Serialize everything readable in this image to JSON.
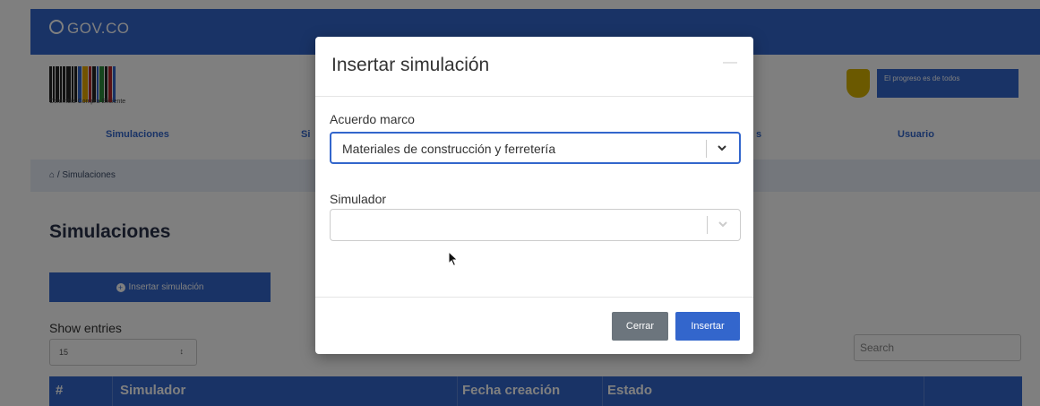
{
  "gov_bar": {
    "logo_text": "GOV.CO"
  },
  "brand": {
    "caption": "Colombia Compra Eficiente"
  },
  "gov_badge": {
    "text": "El progreso es de todos"
  },
  "nav": {
    "items": [
      {
        "label": "Simulaciones"
      },
      {
        "label": "Si"
      },
      {
        "label": "s"
      },
      {
        "label": "Usuario"
      }
    ]
  },
  "breadcrumb": {
    "home_icon": "home-icon",
    "text": "/ Simulaciones"
  },
  "main": {
    "title": "Simulaciones",
    "insert_button": "Insertar simulación",
    "show_entries": "Show entries",
    "entries_value": "15",
    "search_placeholder": "Search",
    "table_headers": [
      "#",
      "Simulador",
      "Fecha creación",
      "Estado"
    ]
  },
  "modal": {
    "title": "Insertar simulación",
    "fields": [
      {
        "label": "Acuerdo marco",
        "value": "Materiales de construcción y ferretería"
      },
      {
        "label": "Simulador",
        "value": ""
      }
    ],
    "close_button": "Cerrar",
    "insert_button": "Insertar"
  },
  "colors": {
    "primary": "#3366cc",
    "secondary": "#6c757d",
    "overlay": "rgba(0,0,0,0.5)"
  }
}
